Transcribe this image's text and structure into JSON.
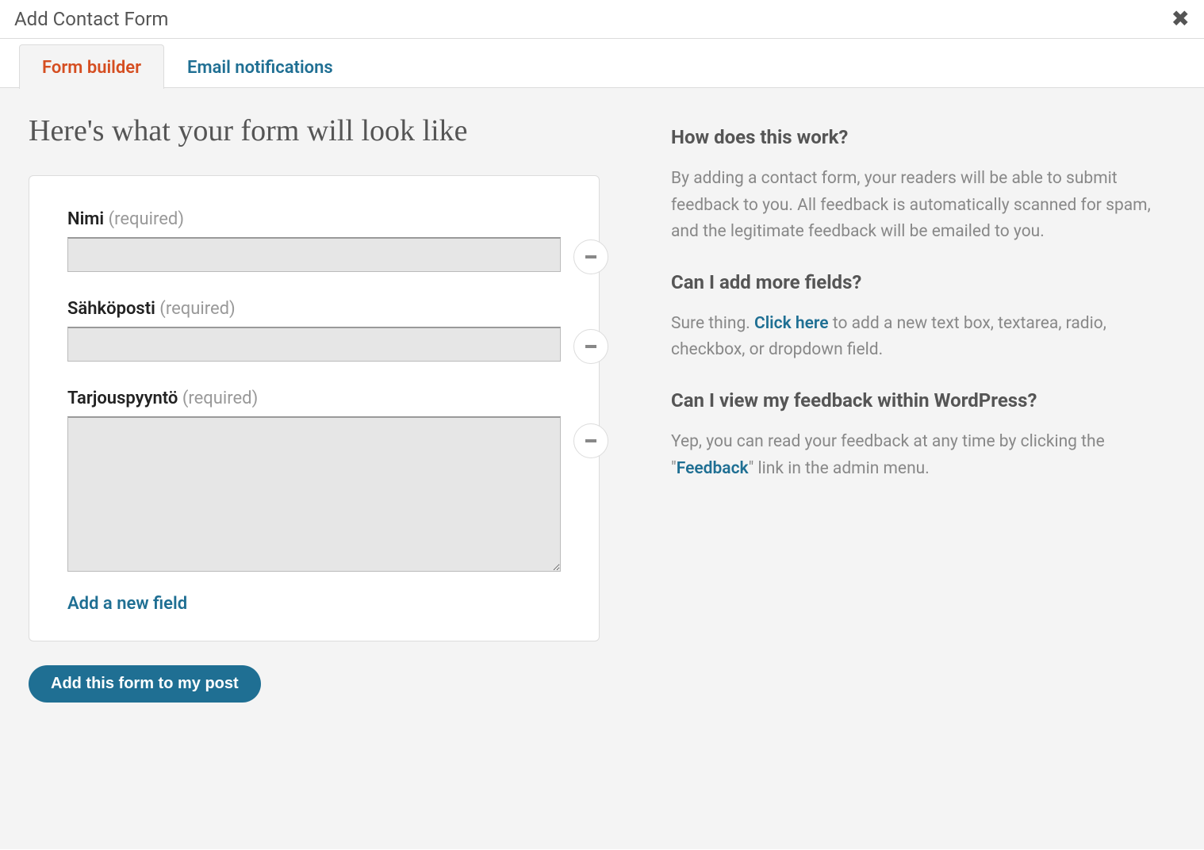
{
  "header": {
    "title": "Add Contact Form"
  },
  "tabs": {
    "builder": "Form builder",
    "notifications": "Email notifications"
  },
  "preview": {
    "title": "Here's what your form will look like",
    "fields": [
      {
        "label": "Nimi",
        "required_text": "(required)",
        "type": "text"
      },
      {
        "label": "Sähköposti",
        "required_text": "(required)",
        "type": "text"
      },
      {
        "label": "Tarjouspyyntö",
        "required_text": "(required)",
        "type": "textarea"
      }
    ],
    "add_field_label": "Add a new field",
    "submit_label": "Add this form to my post"
  },
  "help": {
    "q1": "How does this work?",
    "a1": "By adding a contact form, your readers will be able to submit feedback to you. All feedback is automatically scanned for spam, and the legitimate feedback will be emailed to you.",
    "q2": "Can I add more fields?",
    "a2_pre": "Sure thing. ",
    "a2_link": "Click here",
    "a2_post": " to add a new text box, textarea, radio, checkbox, or dropdown field.",
    "q3": "Can I view my feedback within WordPress?",
    "a3_pre": "Yep, you can read your feedback at any time by clicking the \"",
    "a3_link": "Feedback",
    "a3_post": "\" link in the admin menu."
  }
}
